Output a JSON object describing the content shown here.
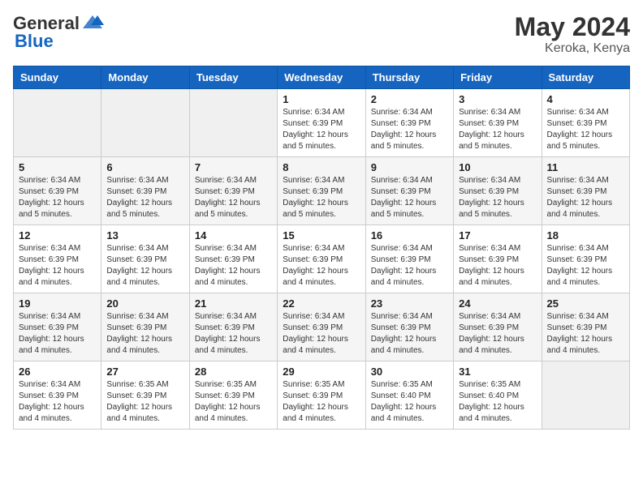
{
  "header": {
    "logo_general": "General",
    "logo_blue": "Blue",
    "month_year": "May 2024",
    "location": "Keroka, Kenya"
  },
  "calendar": {
    "days_of_week": [
      "Sunday",
      "Monday",
      "Tuesday",
      "Wednesday",
      "Thursday",
      "Friday",
      "Saturday"
    ],
    "weeks": [
      [
        {
          "day": "",
          "info": ""
        },
        {
          "day": "",
          "info": ""
        },
        {
          "day": "",
          "info": ""
        },
        {
          "day": "1",
          "info": "Sunrise: 6:34 AM\nSunset: 6:39 PM\nDaylight: 12 hours\nand 5 minutes."
        },
        {
          "day": "2",
          "info": "Sunrise: 6:34 AM\nSunset: 6:39 PM\nDaylight: 12 hours\nand 5 minutes."
        },
        {
          "day": "3",
          "info": "Sunrise: 6:34 AM\nSunset: 6:39 PM\nDaylight: 12 hours\nand 5 minutes."
        },
        {
          "day": "4",
          "info": "Sunrise: 6:34 AM\nSunset: 6:39 PM\nDaylight: 12 hours\nand 5 minutes."
        }
      ],
      [
        {
          "day": "5",
          "info": "Sunrise: 6:34 AM\nSunset: 6:39 PM\nDaylight: 12 hours\nand 5 minutes."
        },
        {
          "day": "6",
          "info": "Sunrise: 6:34 AM\nSunset: 6:39 PM\nDaylight: 12 hours\nand 5 minutes."
        },
        {
          "day": "7",
          "info": "Sunrise: 6:34 AM\nSunset: 6:39 PM\nDaylight: 12 hours\nand 5 minutes."
        },
        {
          "day": "8",
          "info": "Sunrise: 6:34 AM\nSunset: 6:39 PM\nDaylight: 12 hours\nand 5 minutes."
        },
        {
          "day": "9",
          "info": "Sunrise: 6:34 AM\nSunset: 6:39 PM\nDaylight: 12 hours\nand 5 minutes."
        },
        {
          "day": "10",
          "info": "Sunrise: 6:34 AM\nSunset: 6:39 PM\nDaylight: 12 hours\nand 5 minutes."
        },
        {
          "day": "11",
          "info": "Sunrise: 6:34 AM\nSunset: 6:39 PM\nDaylight: 12 hours\nand 4 minutes."
        }
      ],
      [
        {
          "day": "12",
          "info": "Sunrise: 6:34 AM\nSunset: 6:39 PM\nDaylight: 12 hours\nand 4 minutes."
        },
        {
          "day": "13",
          "info": "Sunrise: 6:34 AM\nSunset: 6:39 PM\nDaylight: 12 hours\nand 4 minutes."
        },
        {
          "day": "14",
          "info": "Sunrise: 6:34 AM\nSunset: 6:39 PM\nDaylight: 12 hours\nand 4 minutes."
        },
        {
          "day": "15",
          "info": "Sunrise: 6:34 AM\nSunset: 6:39 PM\nDaylight: 12 hours\nand 4 minutes."
        },
        {
          "day": "16",
          "info": "Sunrise: 6:34 AM\nSunset: 6:39 PM\nDaylight: 12 hours\nand 4 minutes."
        },
        {
          "day": "17",
          "info": "Sunrise: 6:34 AM\nSunset: 6:39 PM\nDaylight: 12 hours\nand 4 minutes."
        },
        {
          "day": "18",
          "info": "Sunrise: 6:34 AM\nSunset: 6:39 PM\nDaylight: 12 hours\nand 4 minutes."
        }
      ],
      [
        {
          "day": "19",
          "info": "Sunrise: 6:34 AM\nSunset: 6:39 PM\nDaylight: 12 hours\nand 4 minutes."
        },
        {
          "day": "20",
          "info": "Sunrise: 6:34 AM\nSunset: 6:39 PM\nDaylight: 12 hours\nand 4 minutes."
        },
        {
          "day": "21",
          "info": "Sunrise: 6:34 AM\nSunset: 6:39 PM\nDaylight: 12 hours\nand 4 minutes."
        },
        {
          "day": "22",
          "info": "Sunrise: 6:34 AM\nSunset: 6:39 PM\nDaylight: 12 hours\nand 4 minutes."
        },
        {
          "day": "23",
          "info": "Sunrise: 6:34 AM\nSunset: 6:39 PM\nDaylight: 12 hours\nand 4 minutes."
        },
        {
          "day": "24",
          "info": "Sunrise: 6:34 AM\nSunset: 6:39 PM\nDaylight: 12 hours\nand 4 minutes."
        },
        {
          "day": "25",
          "info": "Sunrise: 6:34 AM\nSunset: 6:39 PM\nDaylight: 12 hours\nand 4 minutes."
        }
      ],
      [
        {
          "day": "26",
          "info": "Sunrise: 6:34 AM\nSunset: 6:39 PM\nDaylight: 12 hours\nand 4 minutes."
        },
        {
          "day": "27",
          "info": "Sunrise: 6:35 AM\nSunset: 6:39 PM\nDaylight: 12 hours\nand 4 minutes."
        },
        {
          "day": "28",
          "info": "Sunrise: 6:35 AM\nSunset: 6:39 PM\nDaylight: 12 hours\nand 4 minutes."
        },
        {
          "day": "29",
          "info": "Sunrise: 6:35 AM\nSunset: 6:39 PM\nDaylight: 12 hours\nand 4 minutes."
        },
        {
          "day": "30",
          "info": "Sunrise: 6:35 AM\nSunset: 6:40 PM\nDaylight: 12 hours\nand 4 minutes."
        },
        {
          "day": "31",
          "info": "Sunrise: 6:35 AM\nSunset: 6:40 PM\nDaylight: 12 hours\nand 4 minutes."
        },
        {
          "day": "",
          "info": ""
        }
      ]
    ]
  }
}
